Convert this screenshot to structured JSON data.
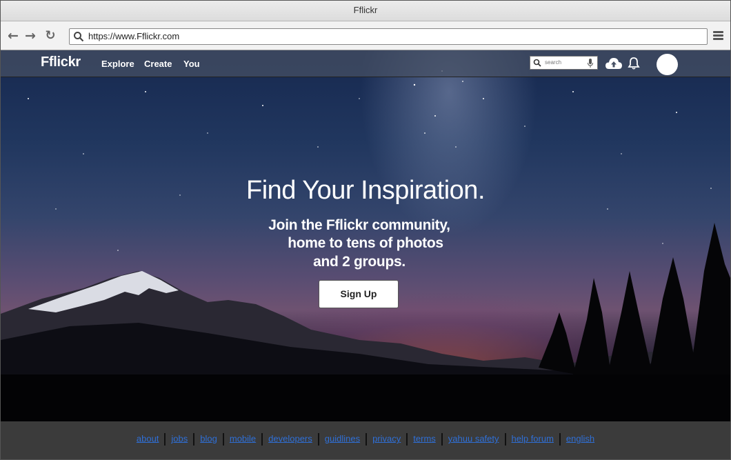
{
  "browser": {
    "window_title": "Fflickr",
    "url": "https://www.Fflickr.com"
  },
  "site_nav": {
    "logo": "Fflickr",
    "links": [
      "Explore",
      "Create",
      "You"
    ],
    "search_placeholder": "search"
  },
  "hero": {
    "headline": "Find Your Inspiration.",
    "subline": [
      "Join the Fflickr community,",
      "home to tens of photos",
      "and 2 groups."
    ],
    "signup_label": "Sign Up"
  },
  "footer": {
    "links": [
      "about",
      "jobs",
      "blog",
      "mobile",
      "developers",
      "guidlines",
      "privacy",
      "terms",
      "yahuu safety",
      "help forum",
      "english"
    ]
  },
  "colors": {
    "link": "#2f6fd6",
    "footer_bg": "#3b3b3b",
    "nav_bg": "#465064"
  },
  "icons": [
    "back-arrow-icon",
    "forward-arrow-icon",
    "reload-icon",
    "search-icon",
    "hamburger-menu-icon",
    "microphone-icon",
    "upload-cloud-icon",
    "bell-icon"
  ]
}
